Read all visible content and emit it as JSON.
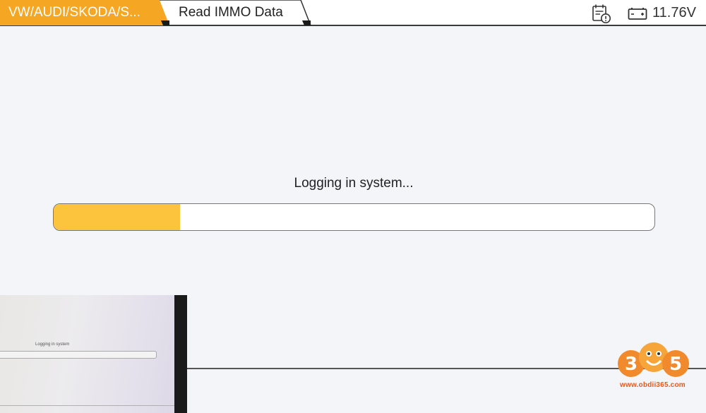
{
  "header": {
    "breadcrumb": [
      {
        "label": "VW/AUDI/SKODA/S...",
        "active": true
      },
      {
        "label": "Read IMMO Data",
        "active": false
      }
    ],
    "voltage": "11.76V",
    "icons": [
      "calendar-alert-icon",
      "battery-icon"
    ]
  },
  "main": {
    "status_text": "Logging in system...",
    "progress": 0.21
  },
  "pip": {
    "status_text": "Logging in system"
  },
  "watermark": {
    "logo_text": "365",
    "url": "www.obdii365.com"
  },
  "colors": {
    "accent": "#f5a623",
    "progress_fill": "#fbc43c",
    "background": "#f3f5f8",
    "watermark_orange": "#e65a1e"
  }
}
